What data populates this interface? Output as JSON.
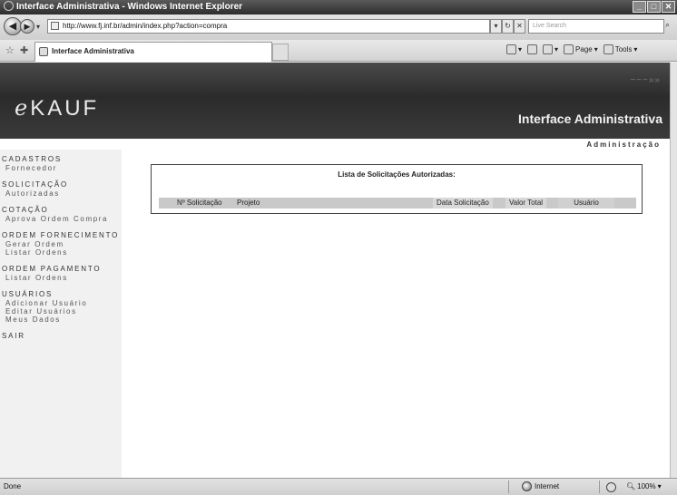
{
  "window": {
    "title": "Interface Administrativa - Windows Internet Explorer"
  },
  "toolbar": {
    "address": "http://www.fj.inf.br/admin/index.php?action=compra",
    "search_placeholder": "Live Search",
    "tab_title": "Interface Administrativa",
    "page_label": "Page",
    "tools_label": "Tools"
  },
  "site": {
    "logo_prefix": "e",
    "logo_rest": "KAUF",
    "header_title": "Interface Administrativa",
    "admin_link": "Administração"
  },
  "menu": [
    {
      "heading": "CADASTROS",
      "items": [
        "Fornecedor"
      ]
    },
    {
      "heading": "SOLICITAÇÃO",
      "items": [
        "Autorizadas"
      ]
    },
    {
      "heading": "COTAÇÃO",
      "items": [
        "Aprova Ordem Compra"
      ]
    },
    {
      "heading": "ORDEM FORNECIMENTO",
      "items": [
        "Gerar Ordem",
        "Listar Ordens"
      ]
    },
    {
      "heading": "ORDEM PAGAMENTO",
      "items": [
        "Listar Ordens"
      ]
    },
    {
      "heading": "USUÁRIOS",
      "items": [
        "Adicionar Usuário",
        "Editar Usuários",
        "Meus Dados"
      ]
    },
    {
      "heading": "SAIR",
      "items": []
    }
  ],
  "list": {
    "title": "Lista de Solicitações Autorizadas:",
    "columns": {
      "num": "Nº Solicitação",
      "projeto": "Projeto",
      "data": "Data Solicitação",
      "valor": "Valor Total",
      "usuario": "Usuário"
    }
  },
  "status": {
    "left": "Done",
    "zone": "Internet",
    "zoom": "100%"
  }
}
